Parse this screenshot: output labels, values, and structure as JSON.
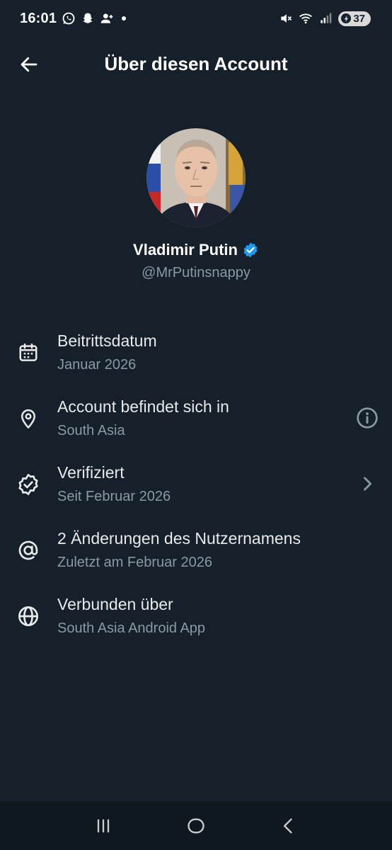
{
  "status_bar": {
    "time": "16:01",
    "battery": "37",
    "icons": [
      "whatsapp-icon",
      "snapchat-icon",
      "person-add-icon",
      "dot-icon",
      "mute-icon",
      "wifi-icon",
      "signal-icon",
      "battery-icon"
    ]
  },
  "header": {
    "title": "Über diesen Account",
    "back_icon": "arrow-left-icon"
  },
  "profile": {
    "name": "Vladimir Putin",
    "handle": "@MrPutinsnappy",
    "verified": true,
    "verified_color": "#1d9bf0"
  },
  "info_rows": [
    {
      "icon": "calendar-icon",
      "title": "Beitrittsdatum",
      "subtitle": "Januar 2026"
    },
    {
      "icon": "location-pin-icon",
      "title": "Account befindet sich in",
      "subtitle": "South Asia",
      "trailing": "info-icon"
    },
    {
      "icon": "verified-badge-icon",
      "title": "Verifiziert",
      "subtitle": "Seit Februar 2026",
      "trailing": "chevron-right-icon"
    },
    {
      "icon": "at-sign-icon",
      "title": "2 Änderungen des Nutzernamens",
      "subtitle": "Zuletzt am Februar 2026"
    },
    {
      "icon": "globe-icon",
      "title": "Verbunden über",
      "subtitle": "South Asia Android App"
    }
  ],
  "nav_bar": {
    "buttons": [
      "recent-apps-icon",
      "home-icon",
      "back-nav-icon"
    ]
  },
  "colors": {
    "background": "#15202b",
    "text_primary": "#e7e9ea",
    "text_secondary": "#8b98a5",
    "accent": "#1d9bf0"
  }
}
